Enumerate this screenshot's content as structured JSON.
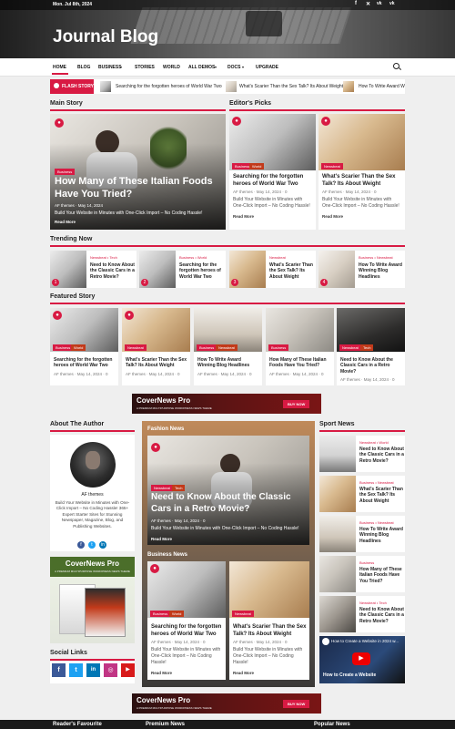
{
  "topbar": {
    "date": "Mon. Jul 8th, 2024",
    "social_icons": [
      "facebook-icon",
      "x-icon",
      "vk-icon",
      "vk-icon"
    ]
  },
  "site": {
    "title": "Journal Blog"
  },
  "nav": {
    "items": [
      "HOME",
      "BLOG",
      "BUSINESS",
      "STORIES",
      "WORLD",
      "ALL DEMOS",
      "DOCS",
      "UPGRADE"
    ],
    "active": "HOME",
    "search_icon": "search-icon"
  },
  "flash": {
    "label": "FLASH STORY",
    "items": [
      "Searching for the forgotten heroes of World War Two",
      "What's Scarier Than the Sex Talk? Its About Weight",
      "How To Write Award Win"
    ]
  },
  "main_story": {
    "heading": "Main Story",
    "category": "Business",
    "title": "How Many of These Italian Foods Have You Tried?",
    "author": "AF themes",
    "date": "May 14, 2024",
    "excerpt": "Build Your Website in Minutes with One-Click Import – No Coding Hassle!",
    "read_more": "Read More"
  },
  "editors_picks": {
    "heading": "Editor's Picks",
    "items": [
      {
        "categories": [
          "Business",
          "World"
        ],
        "title": "Searching for the forgotten heroes of World War Two",
        "author": "AF themes",
        "date": "May 14, 2024",
        "comments": "0",
        "excerpt": "Build Your Website in Minutes with One-Click Import – No Coding Hassle!",
        "read_more": "Read More"
      },
      {
        "categories": [
          "Newsbeat"
        ],
        "title": "What's Scarier Than the Sex Talk? Its About Weight",
        "author": "AF themes",
        "date": "May 14, 2024",
        "comments": "0",
        "excerpt": "Build Your Website in Minutes with One-Click Import – No Coding Hassle!",
        "read_more": "Read More"
      }
    ]
  },
  "trending": {
    "heading": "Trending Now",
    "items": [
      {
        "num": "1",
        "categories": "Newsbeat • Tech",
        "title": "Need to Know About the Classic Cars in a Retro Movie?"
      },
      {
        "num": "2",
        "categories": "Business • World",
        "title": "Searching for the forgotten heroes of World War Two"
      },
      {
        "num": "3",
        "categories": "Newsbeat",
        "title": "What's Scarier Than the Sex Talk? Its About Weight"
      },
      {
        "num": "4",
        "categories": "Business • Newsbeat",
        "title": "How To Write Award Winning Blog Headlines"
      }
    ]
  },
  "featured": {
    "heading": "Featured Story",
    "items": [
      {
        "categories": [
          "Business",
          "World"
        ],
        "title": "Searching for the forgotten heroes of World War Two",
        "author": "AF themes",
        "date": "May 14, 2024",
        "comments": "0"
      },
      {
        "categories": [
          "Newsbeat"
        ],
        "title": "What's Scarier Than the Sex Talk? Its About Weight",
        "author": "AF themes",
        "date": "May 14, 2024",
        "comments": "0"
      },
      {
        "categories": [
          "Business",
          "Newsbeat"
        ],
        "title": "How To Write Award Winning Blog Headlines",
        "author": "AF themes",
        "date": "May 14, 2024",
        "comments": "0"
      },
      {
        "categories": [
          "Business"
        ],
        "title": "How Many of These Italian Foods Have You Tried?",
        "author": "AF themes",
        "date": "May 14, 2024",
        "comments": "0"
      },
      {
        "categories": [
          "Newsbeat",
          "Tech"
        ],
        "title": "Need to Know About the Classic Cars in a Retro Movie?",
        "author": "AF themes",
        "date": "May 14, 2024",
        "comments": "0"
      }
    ]
  },
  "banner": {
    "brand": "CoverNews Pro",
    "tagline": "A PREMIUM MULTIPURPOSE WORDPRESS NEWS THEME",
    "cta": "BUY NOW"
  },
  "author": {
    "heading": "About The Author",
    "name": "AF themes",
    "bio": "Build Your Website in Minutes with One-Click Import – No Coding Hassle! 365+ Expert Starter Sites for Stunning Newspaper, Magazine, Blog, and Publishing Websites.",
    "socials": [
      "facebook-icon",
      "x-icon",
      "linkedin-icon"
    ]
  },
  "ad_box": {
    "brand": "CoverNews Pro",
    "tagline": "A PREMIUM MULTIPURPOSE WORDPRESS NEWS THEME"
  },
  "social_links": {
    "heading": "Social Links",
    "icons": [
      "facebook-icon",
      "x-icon",
      "linkedin-icon",
      "instagram-icon",
      "youtube-icon"
    ],
    "colors": [
      "#3b5998",
      "#1da1f2",
      "#0077b5",
      "#c13584",
      "#d81a1a"
    ]
  },
  "fashion": {
    "heading": "Fashion News",
    "categories": [
      "Newsbeat",
      "Tech"
    ],
    "title": "Need to Know About the Classic Cars in a Retro Movie?",
    "author": "AF themes",
    "date": "May 14, 2024",
    "comments": "0",
    "excerpt": "Build Your Website in Minutes with One-Click Import – No Coding Hassle!",
    "read_more": "Read More"
  },
  "business": {
    "heading": "Business News",
    "items": [
      {
        "categories": [
          "Business",
          "World"
        ],
        "title": "Searching for the forgotten heroes of World War Two",
        "author": "AF themes",
        "date": "May 14, 2024",
        "comments": "0",
        "excerpt": "Build Your Website in Minutes with One-Click Import – No Coding Hassle!",
        "read_more": "Read More"
      },
      {
        "categories": [
          "Newsbeat"
        ],
        "title": "What's Scarier Than the Sex Talk? Its About Weight",
        "author": "AF themes",
        "date": "May 14, 2024",
        "comments": "0",
        "excerpt": "Build Your Website in Minutes with One-Click Import – No Coding Hassle!",
        "read_more": "Read More"
      }
    ]
  },
  "sport": {
    "heading": "Sport News",
    "items": [
      {
        "categories": "Newsbeat • World",
        "title": "Need to Know About the Classic Cars in a Retro Movie?"
      },
      {
        "categories": "Business • Newsbeat",
        "title": "What's Scarier Than the Sex Talk? Its About Weight"
      },
      {
        "categories": "Business • Newsbeat",
        "title": "How To Write Award Winning Blog Headlines"
      },
      {
        "categories": "Business",
        "title": "How Many of These Italian Foods Have You Tried?"
      },
      {
        "categories": "Newsbeat • Tech",
        "title": "Need to Know About the Classic Cars in a Retro Movie?"
      }
    ]
  },
  "video": {
    "title": "How to Create a Website in 2024 w...",
    "overlay": "How to Create a Website"
  },
  "footer_headings": [
    "Reader's Favourite",
    "Premium News",
    "Popular News"
  ]
}
